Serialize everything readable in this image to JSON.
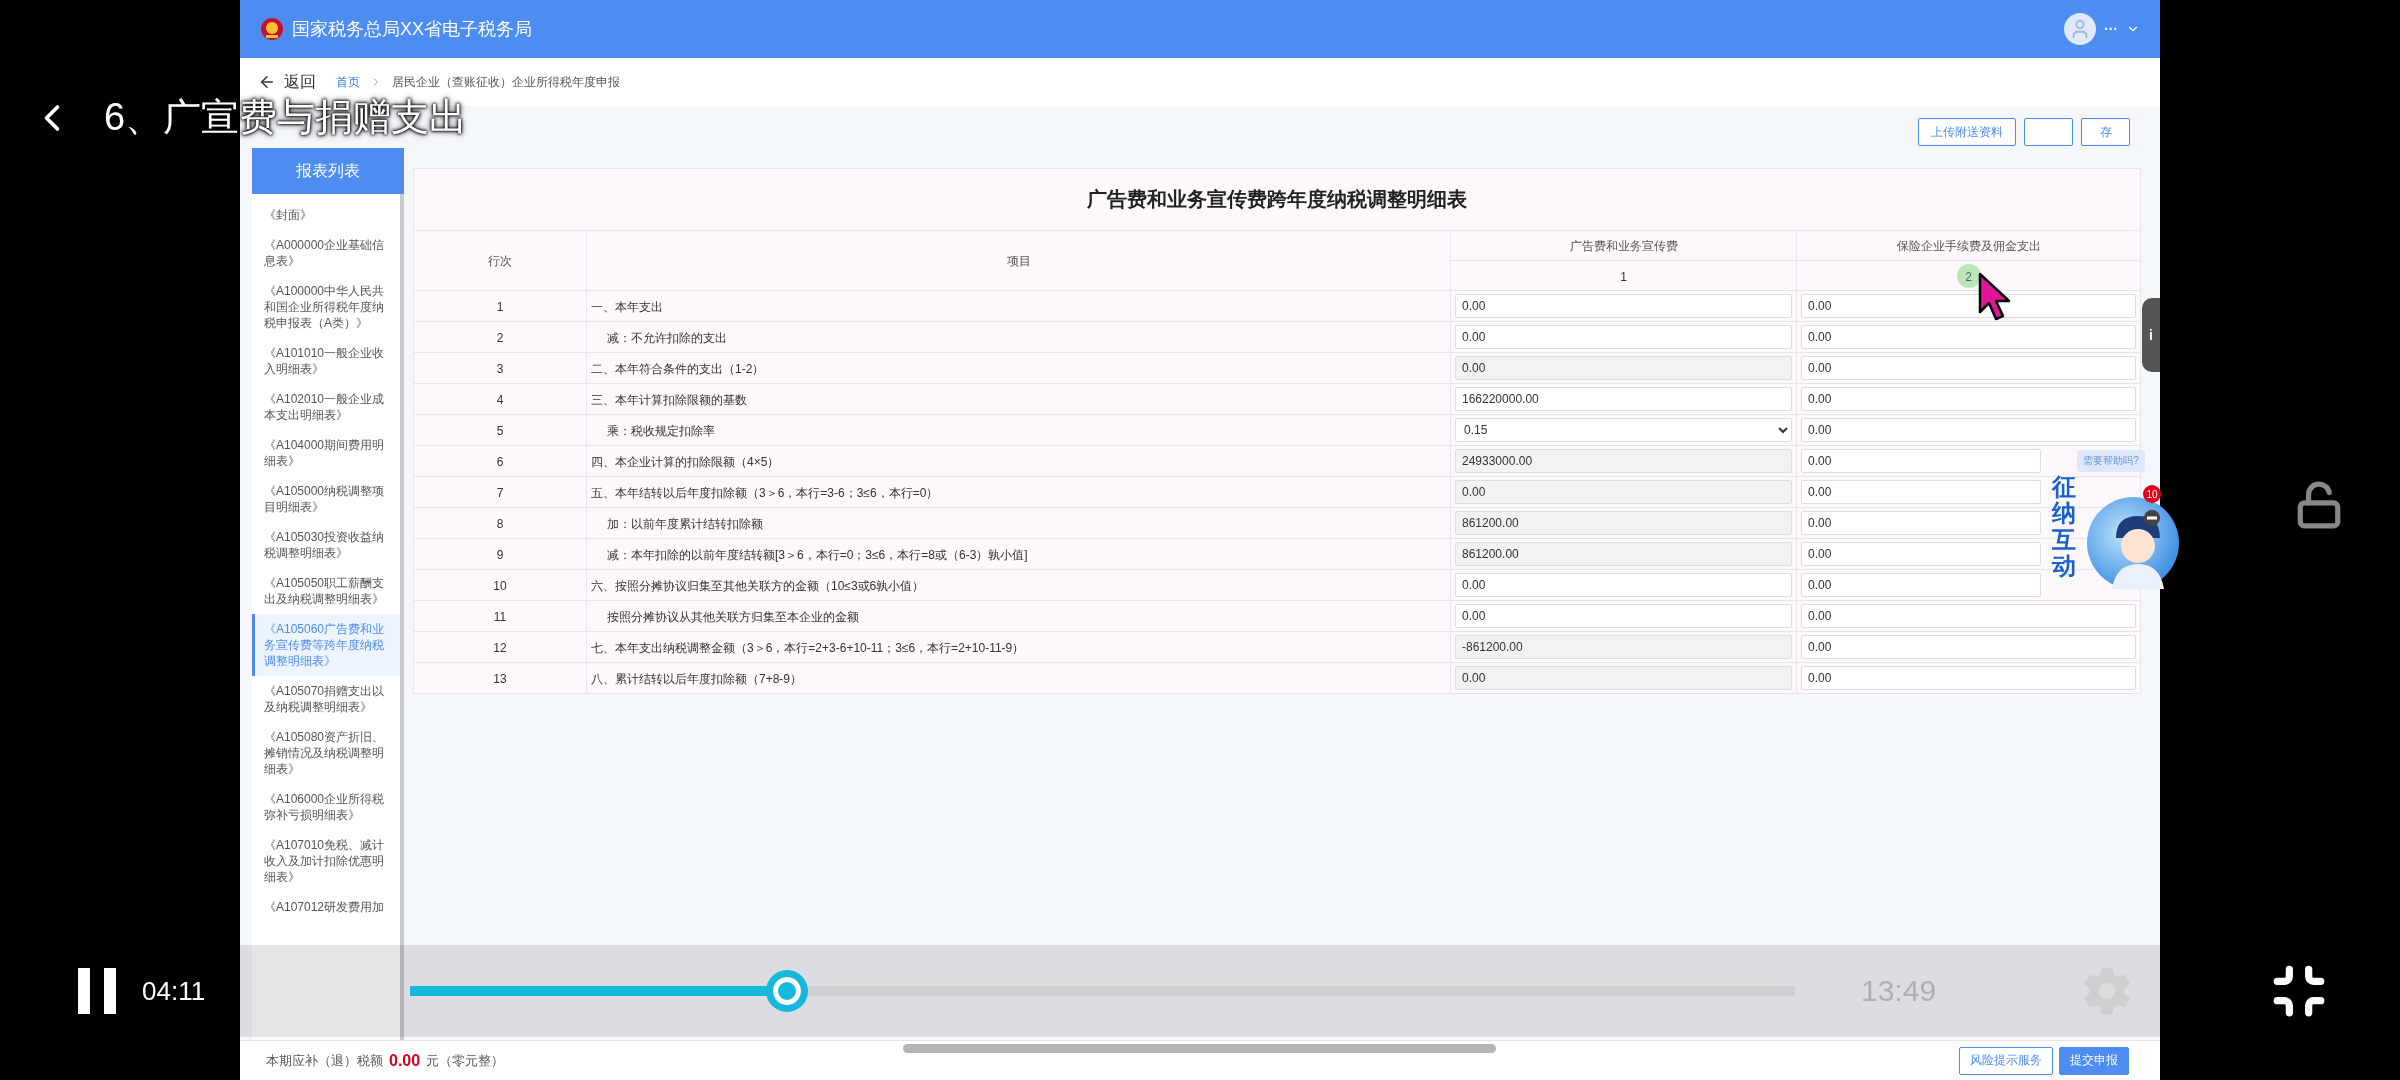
{
  "video_player": {
    "title": "6、广宣费与捐赠支出",
    "playing": true,
    "elapsed": "04:11",
    "duration": "13:49",
    "progress": {
      "level": 0.272
    },
    "locked": false
  },
  "header": {
    "title": "国家税务总局XX省电子税务局",
    "user_menu": "···"
  },
  "breadcrumb": {
    "back": "返回",
    "items": [
      "首页",
      "居民企业（查账征收）企业所得税年度申报"
    ]
  },
  "sidebar": {
    "button": "报表列表",
    "items": [
      {
        "label": "《封面》",
        "selected": false
      },
      {
        "label": "《A000000企业基础信息表》",
        "selected": false
      },
      {
        "label": "《A100000中华人民共和国企业所得税年度纳税申报表（A类）》",
        "selected": false
      },
      {
        "label": "《A101010一般企业收入明细表》",
        "selected": false
      },
      {
        "label": "《A102010一般企业成本支出明细表》",
        "selected": false
      },
      {
        "label": "《A104000期间费用明细表》",
        "selected": false
      },
      {
        "label": "《A105000纳税调整项目明细表》",
        "selected": false
      },
      {
        "label": "《A105030投资收益纳税调整明细表》",
        "selected": false
      },
      {
        "label": "《A105050职工薪酬支出及纳税调整明细表》",
        "selected": false
      },
      {
        "label": "《A105060广告费和业务宣传费等跨年度纳税调整明细表》",
        "selected": true
      },
      {
        "label": "《A105070捐赠支出以及纳税调整明细表》",
        "selected": false
      },
      {
        "label": "《A105080资产折旧、摊销情况及纳税调整明细表》",
        "selected": false
      },
      {
        "label": "《A106000企业所得税弥补亏损明细表》",
        "selected": false
      },
      {
        "label": "《A107010免税、减计收入及加计扣除优惠明细表》",
        "selected": false
      },
      {
        "label": "《A107012研发费用加",
        "selected": false
      }
    ]
  },
  "toolbar": {
    "buttons": [
      {
        "kind": "text",
        "label": "上传附送资料"
      },
      {
        "kind": "blank"
      },
      {
        "kind": "text",
        "label": "存"
      }
    ]
  },
  "form": {
    "title": "广告费和业务宣传费跨年度纳税调整明细表",
    "columns": [
      {
        "label": "行次"
      },
      {
        "label": "项目"
      },
      {
        "label": "广告费和业务宣传费",
        "number": "1"
      },
      {
        "label": "保险企业手续费及佣金支出",
        "number": "2"
      }
    ],
    "rows": [
      {
        "no": "1",
        "item": "一、本年支出",
        "indented": false,
        "cells": [
          {
            "kind": "input",
            "value": "0.00"
          },
          {
            "kind": "input",
            "value": "0.00"
          }
        ]
      },
      {
        "no": "2",
        "item": "减：不允许扣除的支出",
        "indented": true,
        "cells": [
          {
            "kind": "input",
            "value": "0.00"
          },
          {
            "kind": "input",
            "value": "0.00"
          }
        ]
      },
      {
        "no": "3",
        "item": "二、本年符合条件的支出（1-2）",
        "indented": false,
        "cells": [
          {
            "kind": "readonly",
            "value": "0.00"
          },
          {
            "kind": "input",
            "value": "0.00"
          }
        ]
      },
      {
        "no": "4",
        "item": "三、本年计算扣除限额的基数",
        "indented": false,
        "cells": [
          {
            "kind": "input",
            "value": "166220000.00"
          },
          {
            "kind": "input",
            "value": "0.00"
          }
        ]
      },
      {
        "no": "5",
        "item": "乘：税收规定扣除率",
        "indented": true,
        "cells": [
          {
            "kind": "select",
            "value": "0.15"
          },
          {
            "kind": "input",
            "value": "0.00"
          }
        ]
      },
      {
        "no": "6",
        "item": "四、本企业计算的扣除限额（4×5）",
        "indented": false,
        "cells": [
          {
            "kind": "readonly",
            "value": "24933000.00"
          },
          {
            "kind": "input",
            "value": "0.00"
          }
        ]
      },
      {
        "no": "7",
        "item": "五、本年结转以后年度扣除额（3＞6，本行=3-6；3≤6，本行=0）",
        "indented": false,
        "cells": [
          {
            "kind": "readonly",
            "value": "0.00"
          },
          {
            "kind": "input",
            "value": "0.00"
          }
        ]
      },
      {
        "no": "8",
        "item": "加：以前年度累计结转扣除额",
        "indented": true,
        "cells": [
          {
            "kind": "readonly",
            "value": "861200.00"
          },
          {
            "kind": "input",
            "value": "0.00"
          }
        ]
      },
      {
        "no": "9",
        "item": "减：本年扣除的以前年度结转额[3＞6，本行=0；3≤6，本行=8或（6-3）孰小值]",
        "indented": true,
        "cells": [
          {
            "kind": "readonly",
            "value": "861200.00"
          },
          {
            "kind": "input",
            "value": "0.00"
          }
        ]
      },
      {
        "no": "10",
        "item": "六、按照分摊协议归集至其他关联方的金额（10≤3或6孰小值）",
        "indented": false,
        "cells": [
          {
            "kind": "input",
            "value": "0.00"
          },
          {
            "kind": "input",
            "value": "0.00"
          }
        ]
      },
      {
        "no": "11",
        "item": "按照分摊协议从其他关联方归集至本企业的金额",
        "indented": true,
        "cells": [
          {
            "kind": "input",
            "value": "0.00"
          },
          {
            "kind": "input",
            "value": "0.00"
          }
        ]
      },
      {
        "no": "12",
        "item": "七、本年支出纳税调整金额（3＞6，本行=2+3-6+10-11；3≤6，本行=2+10-11-9）",
        "indented": false,
        "cells": [
          {
            "kind": "readonly",
            "value": "-861200.00"
          },
          {
            "kind": "input",
            "value": "0.00"
          }
        ]
      },
      {
        "no": "13",
        "item": "八、累计结转以后年度扣除额（7+8-9）",
        "indented": false,
        "cells": [
          {
            "kind": "readonly",
            "value": "0.00"
          },
          {
            "kind": "input",
            "value": "0.00"
          }
        ]
      }
    ]
  },
  "info_tab": {
    "glyph": "i"
  },
  "assistant": {
    "hint": "需要帮助吗?",
    "name": "征纳互动",
    "badge": "10"
  },
  "footer": {
    "label": "本期应补（退）税额",
    "amount": "0.00",
    "note": "元（零元整）",
    "buttons": [
      {
        "label": "风险提示服务",
        "primary": false
      },
      {
        "label": "提交申报",
        "primary": true
      }
    ]
  }
}
